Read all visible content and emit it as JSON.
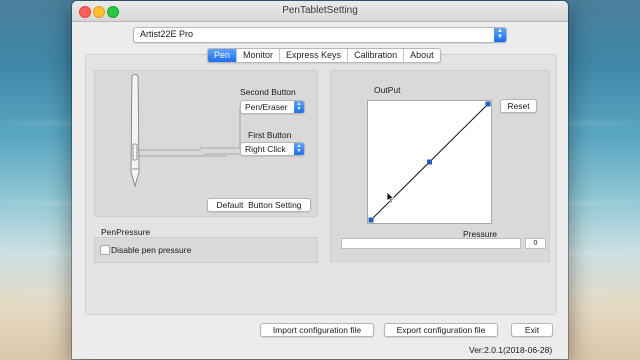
{
  "window": {
    "title": "PenTabletSetting"
  },
  "device": {
    "selected": "Artist22E Pro"
  },
  "tabs": [
    {
      "label": "Pen",
      "active": true
    },
    {
      "label": "Monitor",
      "active": false
    },
    {
      "label": "Express Keys",
      "active": false
    },
    {
      "label": "Calibration",
      "active": false
    },
    {
      "label": "About",
      "active": false
    }
  ],
  "pen": {
    "second_button_label": "Second Button",
    "second_button_value": "Pen/Eraser",
    "first_button_label": "First Button",
    "first_button_value": "Right Click",
    "default_button_label": "Default  Button Setting"
  },
  "pen_pressure": {
    "group_label": "PenPressure",
    "disable_label": "Disable pen pressure",
    "disable_checked": false
  },
  "output": {
    "label": "OutPut",
    "reset_label": "Reset",
    "curve_points": [
      [
        0,
        0
      ],
      [
        0.5,
        0.5
      ],
      [
        1,
        1
      ]
    ],
    "pressure_label": "Pressure",
    "pressure_value": "0",
    "pressure_fraction": 0
  },
  "footer": {
    "import_label": "Import configuration file",
    "export_label": "Export configuration file",
    "exit_label": "Exit",
    "version": "Ver:2.0.1(2018-06-28)"
  },
  "colors": {
    "accent": "#1d6ff2",
    "curve_handle": "#1f5fc7"
  }
}
